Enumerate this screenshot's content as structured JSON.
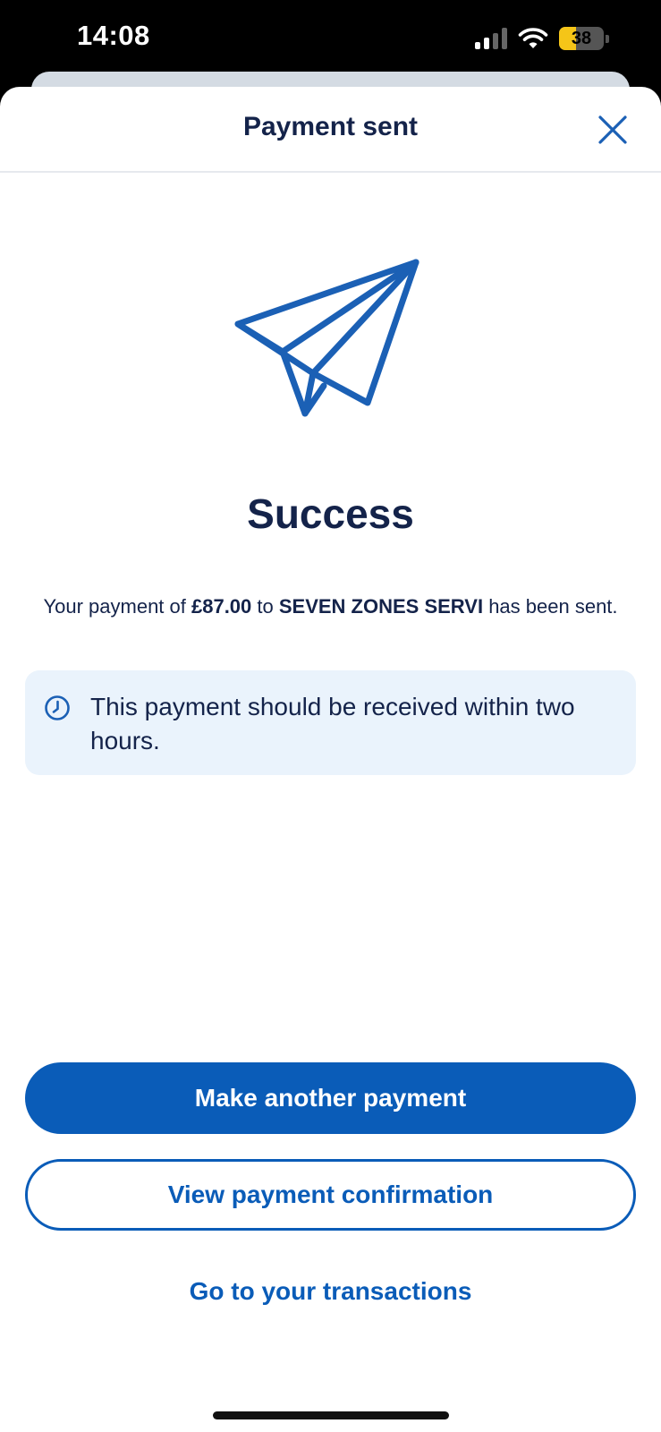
{
  "status_bar": {
    "time": "14:08",
    "battery_level": "38",
    "battery_fraction": 0.38,
    "battery_color": "#f5c518",
    "signal_icon": "cellular-signal-icon",
    "wifi_icon": "wifi-icon"
  },
  "header": {
    "title": "Payment sent",
    "close_icon": "close-icon"
  },
  "illustration": {
    "icon": "paper-plane-icon",
    "color": "#1b60b5"
  },
  "main": {
    "heading": "Success",
    "message_prefix": "Your payment of ",
    "amount": "£87.00",
    "message_mid": " to ",
    "payee": "SEVEN ZONES  SERVI",
    "message_suffix": " has been sent."
  },
  "info": {
    "icon": "clock-icon",
    "text": "This payment should be received within two hours."
  },
  "actions": {
    "primary_label": "Make another payment",
    "secondary_label": "View payment confirmation",
    "link_label": "Go to your transactions"
  },
  "colors": {
    "brand_blue": "#0a5cb8",
    "navy_text": "#14234a",
    "info_bg": "#eaf3fc"
  }
}
